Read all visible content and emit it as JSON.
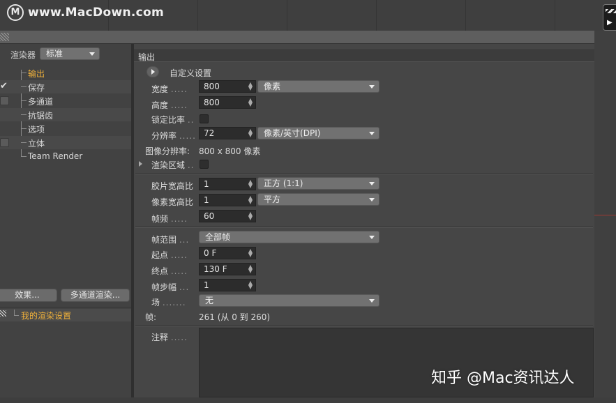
{
  "watermark_top": {
    "logo_letter": "M",
    "site": "www.MacDown.com"
  },
  "left_panel": {
    "renderer_label": "渲染器",
    "renderer_value": "标准",
    "tree": [
      {
        "label": "输出",
        "active": true,
        "checkbox": "none"
      },
      {
        "label": "保存",
        "active": false,
        "checkbox": "checked"
      },
      {
        "label": "多通道",
        "active": false,
        "checkbox": "empty"
      },
      {
        "label": "抗锯齿",
        "active": false,
        "checkbox": "none"
      },
      {
        "label": "选项",
        "active": false,
        "checkbox": "none"
      },
      {
        "label": "立体",
        "active": false,
        "checkbox": "empty"
      },
      {
        "label": "Team Render",
        "active": false,
        "checkbox": "none"
      }
    ],
    "effects_button": "效果...",
    "multipass_button": "多通道渲染...",
    "preset_name": "我的渲染设置"
  },
  "output": {
    "section_title": "输出",
    "preset_label": "自定义设置",
    "width_label": "宽度",
    "width_value": "800",
    "width_unit": "像素",
    "height_label": "高度",
    "height_value": "800",
    "lock_ratio_label": "锁定比率",
    "resolution_label": "分辨率",
    "resolution_value": "72",
    "resolution_unit": "像素/英寸(DPI)",
    "image_resolution_label": "图像分辨率:",
    "image_resolution_value": "800 x 800 像素",
    "render_region_label": "渲染区域",
    "film_aspect_label": "胶片宽高比",
    "film_aspect_value": "1",
    "film_aspect_preset": "正方 (1:1)",
    "pixel_aspect_label": "像素宽高比",
    "pixel_aspect_value": "1",
    "pixel_aspect_preset": "平方",
    "frame_rate_label": "帧频",
    "frame_rate_value": "60",
    "frame_range_label": "帧范围",
    "frame_range_value": "全部帧",
    "start_label": "起点",
    "start_value": "0 F",
    "end_label": "终点",
    "end_value": "130 F",
    "step_label": "帧步幅",
    "step_value": "1",
    "field_label": "场",
    "field_value": "无",
    "frames_label": "帧:",
    "frames_value": "261 (从 0 到 260)",
    "notes_label": "注释"
  },
  "dots": {
    "d5": ".....",
    "d2": "..",
    "d3": "...",
    "d7": "......."
  },
  "watermark_bottom": "知乎 @Mac资讯达人",
  "colors": {
    "active_item": "#f0b13a",
    "panel_bg": "#464646",
    "field_bg": "#2c2c2c"
  }
}
